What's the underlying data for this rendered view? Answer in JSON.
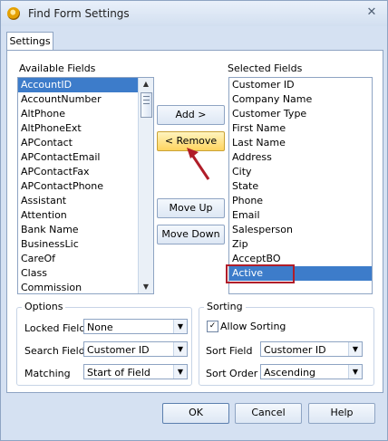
{
  "window": {
    "title": "Find Form Settings",
    "close_glyph": "✕"
  },
  "tab": {
    "label": "Settings"
  },
  "available": {
    "label": "Available Fields",
    "items": [
      "AccountID",
      "AccountNumber",
      "AltPhone",
      "AltPhoneExt",
      "APContact",
      "APContactEmail",
      "APContactFax",
      "APContactPhone",
      "Assistant",
      "Attention",
      "Bank Name",
      "BusinessLic",
      "CareOf",
      "Class",
      "Commission"
    ],
    "selected": "AccountID"
  },
  "selectedFields": {
    "label": "Selected Fields",
    "items": [
      "Customer ID",
      "Company Name",
      "Customer Type",
      "First Name",
      "Last Name",
      "Address",
      "City",
      "State",
      "Phone",
      "Email",
      "Salesperson",
      "Zip",
      "AcceptBO",
      "Active"
    ],
    "selected": "Active"
  },
  "buttons": {
    "add": "Add >",
    "remove": "< Remove",
    "move_up": "Move Up",
    "move_down": "Move Down",
    "ok": "OK",
    "cancel": "Cancel",
    "help": "Help"
  },
  "options": {
    "title": "Options",
    "locked_label": "Locked Field",
    "locked_value": "None",
    "search_label": "Search Field",
    "search_value": "Customer ID",
    "matching_label": "Matching",
    "matching_value": "Start of Field"
  },
  "sorting": {
    "title": "Sorting",
    "allow_label": "Allow Sorting",
    "allow_checked": true,
    "check_glyph": "✓",
    "sort_field_label": "Sort Field",
    "sort_field_value": "Customer ID",
    "sort_order_label": "Sort Order",
    "sort_order_value": "Ascending"
  },
  "icons": {
    "dropdown": "▼",
    "up": "▲",
    "down": "▼",
    "arrow": "↖"
  },
  "colors": {
    "highlight": "#3d7cca",
    "annotation": "#b01d29"
  }
}
